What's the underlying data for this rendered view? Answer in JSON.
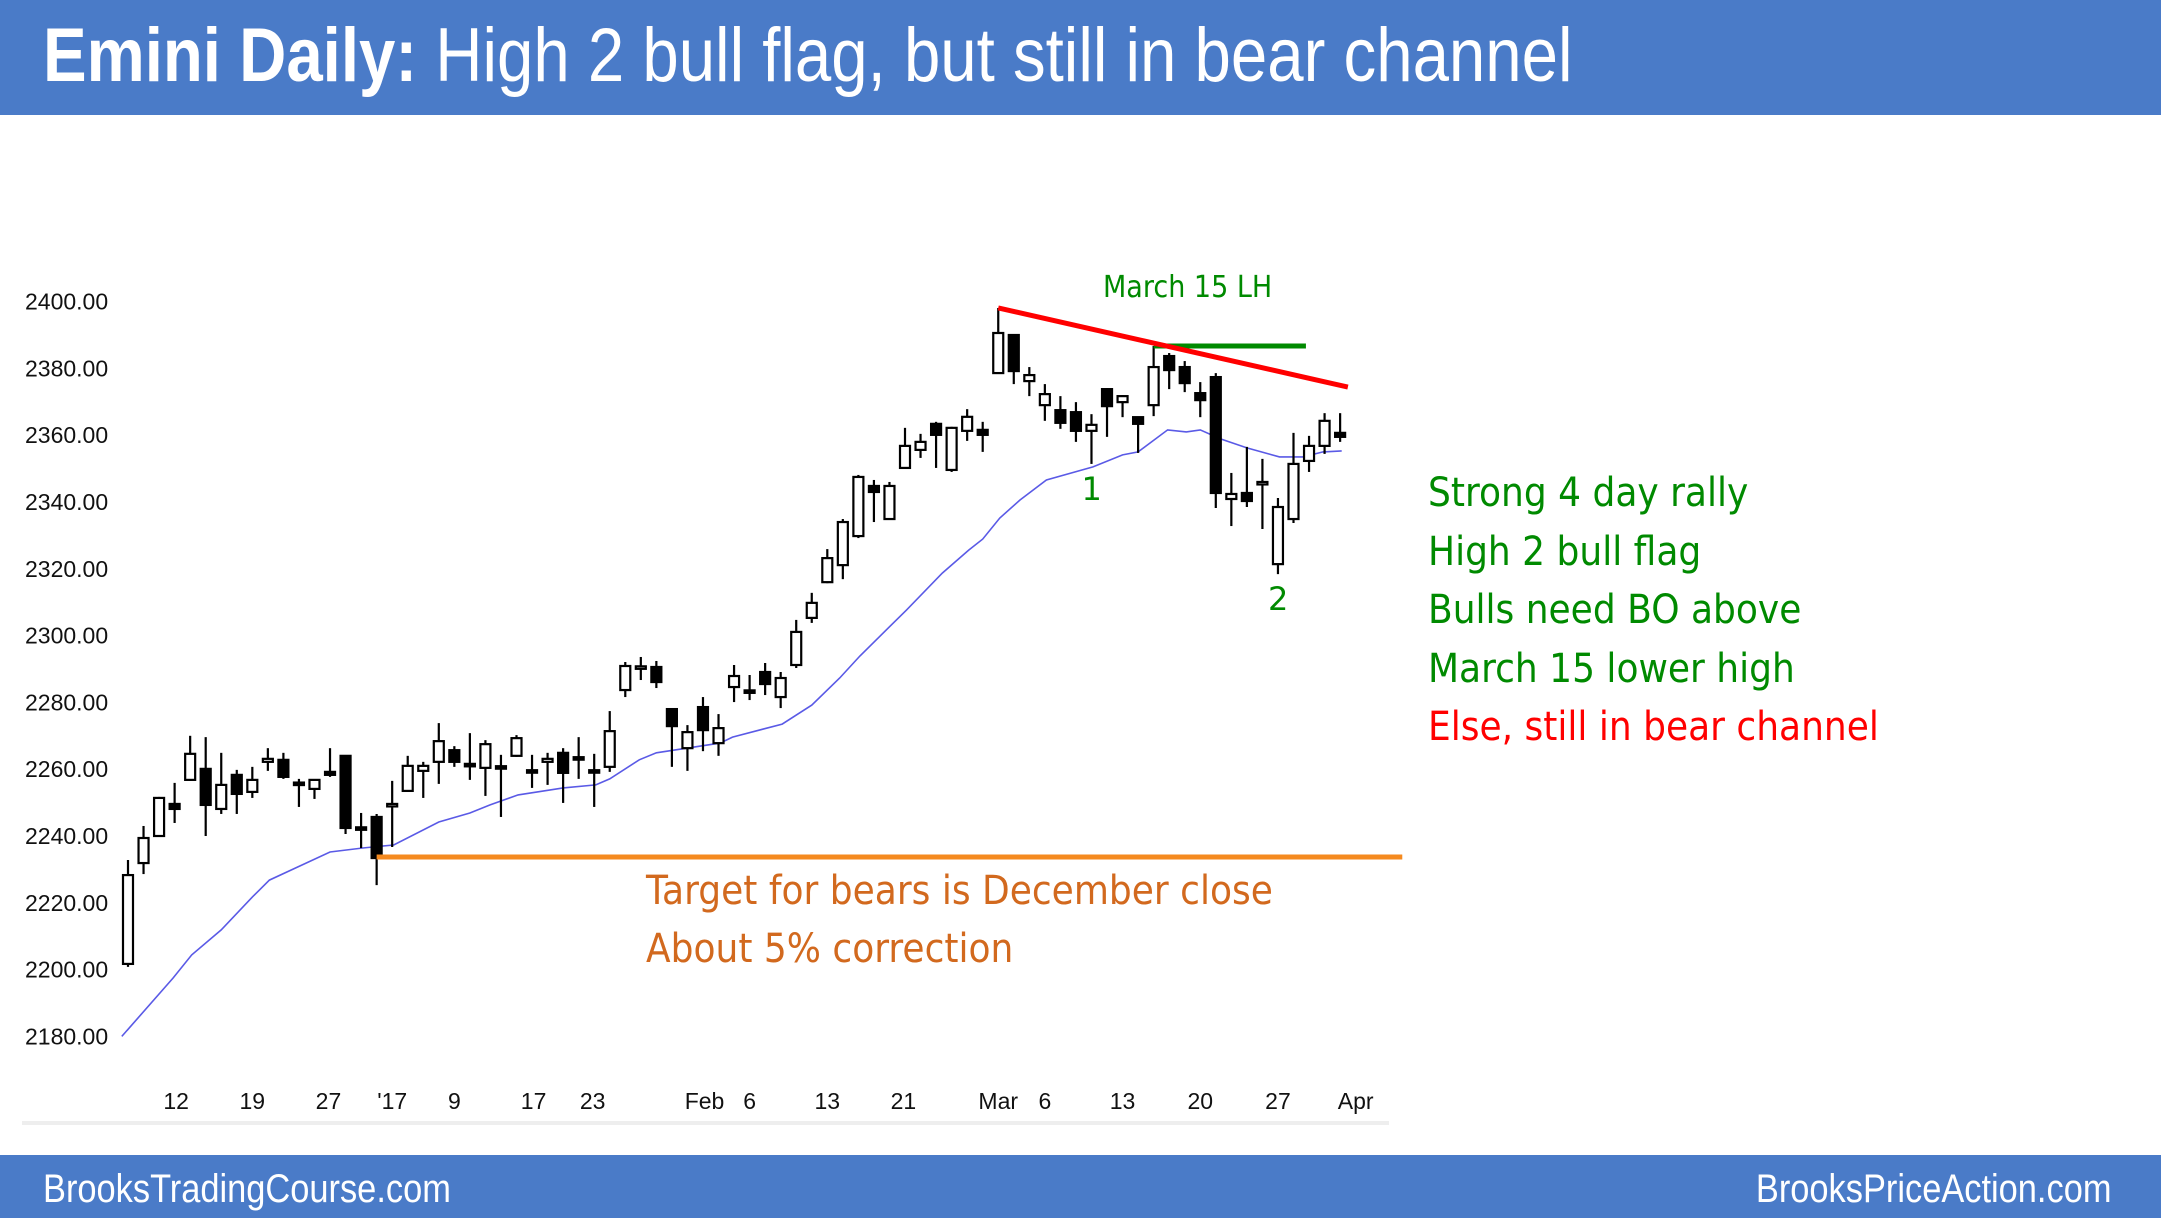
{
  "header": {
    "title_bold": "Emini Daily:",
    "title_rest": " High 2 bull flag, but still in bear channel",
    "background": "#4a7bc8"
  },
  "footer": {
    "left": "BrooksTradingCourse.com",
    "right": "BrooksPriceAction.com"
  },
  "notes_right": [
    {
      "text": "Strong 4 day rally",
      "color": "#008a00"
    },
    {
      "text": "High 2 bull flag",
      "color": "#008a00"
    },
    {
      "text": "Bulls need BO above",
      "color": "#008a00"
    },
    {
      "text": "March 15 lower high",
      "color": "#008a00"
    },
    {
      "text": "Else, still in bear channel",
      "color": "#ff0000"
    }
  ],
  "notes_bear": [
    {
      "text": "Target for bears is December close",
      "color": "#d2691e"
    },
    {
      "text": "About 5% correction",
      "color": "#d2691e"
    }
  ],
  "chart_data": {
    "type": "candlestick",
    "title": "Emini Daily: High 2 bull flag, but still in bear channel",
    "xlabel": "",
    "ylabel": "",
    "ylim": [
      2172,
      2405
    ],
    "grid": false,
    "legend": "none",
    "y_ticks": [
      "2180.00",
      "2200.00",
      "2220.00",
      "2240.00",
      "2260.00",
      "2280.00",
      "2300.00",
      "2320.00",
      "2340.00",
      "2360.00",
      "2380.00",
      "2400.00"
    ],
    "x_ticks": [
      {
        "label": "12",
        "bar": 4.1
      },
      {
        "label": "19",
        "bar": 9.0
      },
      {
        "label": "27",
        "bar": 13.9
      },
      {
        "label": "'17",
        "bar": 18.0
      },
      {
        "label": "9",
        "bar": 22.0
      },
      {
        "label": "17",
        "bar": 27.1
      },
      {
        "label": "23",
        "bar": 30.9
      },
      {
        "label": "Feb",
        "bar": 38.1
      },
      {
        "label": "6",
        "bar": 41.0
      },
      {
        "label": "13",
        "bar": 46.0
      },
      {
        "label": "21",
        "bar": 50.9
      },
      {
        "label": "Mar",
        "bar": 57.0
      },
      {
        "label": "6",
        "bar": 60.0
      },
      {
        "label": "13",
        "bar": 65.0
      },
      {
        "label": "20",
        "bar": 70.0
      },
      {
        "label": "27",
        "bar": 75.0
      },
      {
        "label": "Apr",
        "bar": 80.0
      }
    ],
    "candles_ohlc": [
      [
        2201.7,
        2232.8,
        2200.8,
        2228.3
      ],
      [
        2231.9,
        2243.0,
        2228.6,
        2239.4
      ],
      [
        2240.0,
        2251.7,
        2239.7,
        2251.4
      ],
      [
        2249.6,
        2255.9,
        2243.9,
        2248.1
      ],
      [
        2256.8,
        2270.0,
        2256.5,
        2264.6
      ],
      [
        2260.1,
        2269.6,
        2240.0,
        2249.3
      ],
      [
        2248.1,
        2264.9,
        2246.6,
        2255.3
      ],
      [
        2258.3,
        2259.8,
        2246.6,
        2252.6
      ],
      [
        2253.2,
        2260.7,
        2251.4,
        2256.8
      ],
      [
        2262.2,
        2266.3,
        2259.5,
        2263.1
      ],
      [
        2262.8,
        2264.9,
        2257.1,
        2257.7
      ],
      [
        2256.0,
        2257.1,
        2248.7,
        2255.8
      ],
      [
        2254.1,
        2256.8,
        2251.1,
        2256.8
      ],
      [
        2259.2,
        2266.3,
        2257.7,
        2258.3
      ],
      [
        2264.0,
        2264.0,
        2240.6,
        2242.4
      ],
      [
        2242.6,
        2246.9,
        2236.4,
        2242.2
      ],
      [
        2245.7,
        2246.6,
        2225.3,
        2233.4
      ],
      [
        2249.0,
        2256.5,
        2236.7,
        2249.6
      ],
      [
        2253.5,
        2264.0,
        2253.2,
        2261.0
      ],
      [
        2259.5,
        2262.2,
        2251.4,
        2261.0
      ],
      [
        2262.2,
        2273.8,
        2255.6,
        2268.4
      ],
      [
        2265.7,
        2266.9,
        2260.7,
        2262.2
      ],
      [
        2261.6,
        2270.8,
        2256.8,
        2261.0
      ],
      [
        2260.4,
        2268.7,
        2252.0,
        2267.5
      ],
      [
        2260.9,
        2264.3,
        2245.7,
        2260.5
      ],
      [
        2264.0,
        2270.2,
        2263.7,
        2269.3
      ],
      [
        2259.7,
        2264.3,
        2254.4,
        2259.3
      ],
      [
        2262.2,
        2264.9,
        2255.3,
        2263.1
      ],
      [
        2264.9,
        2266.3,
        2249.9,
        2258.9
      ],
      [
        2263.6,
        2269.6,
        2257.1,
        2263.2
      ],
      [
        2259.7,
        2264.6,
        2248.7,
        2259.3
      ],
      [
        2260.7,
        2277.4,
        2259.2,
        2271.4
      ],
      [
        2283.7,
        2292.1,
        2281.6,
        2290.9
      ],
      [
        2290.4,
        2293.6,
        2286.7,
        2290.8
      ],
      [
        2290.6,
        2292.4,
        2284.3,
        2286.1
      ],
      [
        2278.0,
        2278.3,
        2260.7,
        2272.9
      ],
      [
        2266.3,
        2273.2,
        2259.5,
        2271.1
      ],
      [
        2278.6,
        2281.6,
        2265.4,
        2271.7
      ],
      [
        2267.8,
        2276.5,
        2264.0,
        2272.3
      ],
      [
        2284.6,
        2291.2,
        2280.1,
        2287.9
      ],
      [
        2283.6,
        2288.2,
        2280.7,
        2283.2
      ],
      [
        2289.1,
        2291.8,
        2282.2,
        2285.5
      ],
      [
        2281.6,
        2289.1,
        2278.3,
        2287.3
      ],
      [
        2291.2,
        2304.7,
        2290.3,
        2301.1
      ],
      [
        2305.3,
        2312.8,
        2303.8,
        2309.8
      ],
      [
        2316.0,
        2325.9,
        2315.7,
        2323.2
      ],
      [
        2321.1,
        2334.9,
        2316.9,
        2334.0
      ],
      [
        2329.8,
        2348.1,
        2329.2,
        2347.5
      ],
      [
        2344.8,
        2346.6,
        2334.0,
        2343.0
      ],
      [
        2334.9,
        2346.0,
        2334.9,
        2344.8
      ],
      [
        2350.2,
        2362.2,
        2350.2,
        2356.8
      ],
      [
        2355.6,
        2360.4,
        2353.2,
        2358.0
      ],
      [
        2363.4,
        2364.0,
        2350.2,
        2360.1
      ],
      [
        2349.6,
        2362.5,
        2349.0,
        2362.2
      ],
      [
        2361.3,
        2367.8,
        2358.3,
        2365.5
      ],
      [
        2361.6,
        2364.0,
        2355.0,
        2360.1
      ],
      [
        2378.6,
        2398.1,
        2378.6,
        2390.6
      ],
      [
        2390.0,
        2390.0,
        2375.3,
        2379.2
      ],
      [
        2376.2,
        2380.4,
        2371.7,
        2378.0
      ],
      [
        2369.0,
        2375.3,
        2364.3,
        2372.3
      ],
      [
        2367.5,
        2371.7,
        2361.9,
        2363.7
      ],
      [
        2366.9,
        2369.9,
        2358.0,
        2361.3
      ],
      [
        2361.3,
        2366.3,
        2351.4,
        2363.1
      ],
      [
        2373.8,
        2374.1,
        2359.5,
        2368.7
      ],
      [
        2369.9,
        2372.0,
        2365.4,
        2371.7
      ],
      [
        2365.4,
        2365.4,
        2354.7,
        2363.4
      ],
      [
        2369.0,
        2386.7,
        2365.7,
        2380.4
      ],
      [
        2383.7,
        2384.6,
        2373.8,
        2379.5
      ],
      [
        2380.4,
        2382.2,
        2372.9,
        2375.6
      ],
      [
        2372.6,
        2375.9,
        2365.4,
        2370.5
      ],
      [
        2377.4,
        2378.6,
        2338.2,
        2342.7
      ],
      [
        2340.9,
        2348.7,
        2332.8,
        2342.4
      ],
      [
        2342.7,
        2356.5,
        2338.5,
        2340.3
      ],
      [
        2345.4,
        2352.9,
        2331.9,
        2346.0
      ],
      [
        2321.4,
        2341.2,
        2318.4,
        2338.5
      ],
      [
        2334.9,
        2360.7,
        2333.7,
        2351.4
      ],
      [
        2352.3,
        2359.8,
        2349.0,
        2356.8
      ],
      [
        2356.8,
        2366.6,
        2354.4,
        2364.3
      ],
      [
        2360.7,
        2366.6,
        2358.0,
        2359.5
      ]
    ],
    "moving_average": {
      "name": "20-bar EMA",
      "color": "#5a5ae6",
      "points_bar_value": [
        [
          0.6,
          2180.0
        ],
        [
          3.9,
          2197.5
        ],
        [
          5.1,
          2204.4
        ],
        [
          7.0,
          2211.9
        ],
        [
          9.0,
          2221.7
        ],
        [
          10.1,
          2226.8
        ],
        [
          11.9,
          2230.7
        ],
        [
          14.0,
          2235.2
        ],
        [
          16.1,
          2236.4
        ],
        [
          18.1,
          2237.3
        ],
        [
          21.0,
          2244.2
        ],
        [
          23.0,
          2246.9
        ],
        [
          24.3,
          2249.3
        ],
        [
          26.1,
          2252.3
        ],
        [
          29.0,
          2254.4
        ],
        [
          31.1,
          2255.3
        ],
        [
          32.0,
          2257.1
        ],
        [
          33.9,
          2262.8
        ],
        [
          35.0,
          2264.9
        ],
        [
          39.1,
          2267.8
        ],
        [
          39.9,
          2269.6
        ],
        [
          43.1,
          2273.5
        ],
        [
          45.0,
          2279.2
        ],
        [
          46.8,
          2287.3
        ],
        [
          48.1,
          2293.9
        ],
        [
          51.1,
          2307.7
        ],
        [
          53.4,
          2318.7
        ],
        [
          55.1,
          2325.6
        ],
        [
          56.0,
          2328.9
        ],
        [
          57.1,
          2335.2
        ],
        [
          58.4,
          2340.6
        ],
        [
          60.1,
          2346.6
        ],
        [
          63.1,
          2350.5
        ],
        [
          65.0,
          2354.1
        ],
        [
          66.0,
          2355.0
        ],
        [
          67.9,
          2361.6
        ],
        [
          69.1,
          2361.0
        ],
        [
          70.0,
          2361.6
        ],
        [
          71.3,
          2358.9
        ],
        [
          73.0,
          2356.2
        ],
        [
          75.1,
          2353.5
        ],
        [
          76.6,
          2353.5
        ],
        [
          77.9,
          2355.0
        ],
        [
          79.1,
          2355.3
        ]
      ]
    },
    "annotations": {
      "bear_trendline": {
        "color": "#ff0000",
        "from": [
          57,
          2398.1
        ],
        "to": [
          79.5,
          2374.4
        ]
      },
      "lower_high_line": {
        "color": "#008a00",
        "value": 2386.7,
        "from_bar": 67,
        "to_bar": 76.8,
        "label": "March 15 LH"
      },
      "december_close_line": {
        "color": "#f58a1f",
        "value": 2233.7,
        "from_bar": 17,
        "to_bar": 83
      },
      "swing_labels": [
        {
          "text": "1",
          "bar": 63,
          "color": "#008a00"
        },
        {
          "text": "2",
          "bar": 75,
          "color": "#008a00"
        }
      ]
    }
  }
}
